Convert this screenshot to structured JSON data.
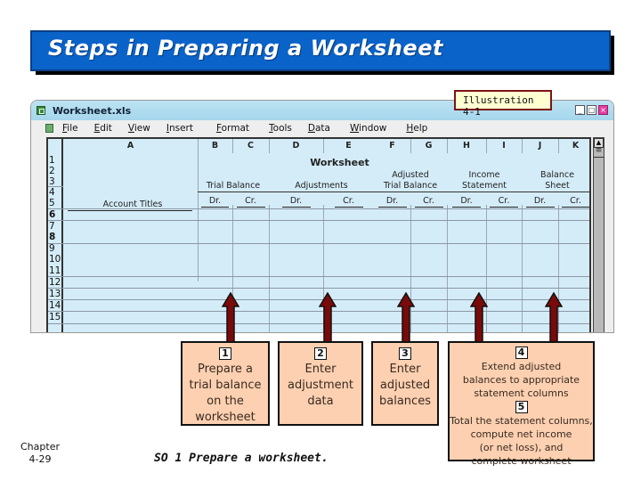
{
  "slide": {
    "title": "Steps in Preparing a Worksheet",
    "illustration_label": "Illustration 4-1",
    "chapter_label": "Chapter",
    "chapter_page": "4-29",
    "study_objective": "SO 1  Prepare a worksheet."
  },
  "window": {
    "title": "Worksheet.xls",
    "controls": [
      "minimize",
      "maximize",
      "close"
    ],
    "menu": [
      "File",
      "Edit",
      "View",
      "Insert",
      "Format",
      "Tools",
      "Data",
      "Window",
      "Help"
    ]
  },
  "sheet": {
    "columns": [
      "A",
      "B",
      "C",
      "D",
      "E",
      "F",
      "G",
      "H",
      "I",
      "J",
      "K"
    ],
    "rows": [
      "1",
      "2",
      "3",
      "4",
      "5",
      "6",
      "7",
      "8",
      "9",
      "10",
      "11",
      "12",
      "13",
      "14",
      "15"
    ],
    "heading": "Worksheet",
    "account_titles": "Account Titles",
    "groups": [
      {
        "line1": "",
        "line2": "Trial Balance"
      },
      {
        "line1": "",
        "line2": "Adjustments"
      },
      {
        "line1": "Adjusted",
        "line2": "Trial Balance"
      },
      {
        "line1": "Income",
        "line2": "Statement"
      },
      {
        "line1": "Balance",
        "line2": "Sheet"
      }
    ],
    "dr_label": "Dr.",
    "cr_label": "Cr."
  },
  "steps": [
    {
      "number": "1",
      "text": [
        "Prepare a",
        "trial balance",
        "on the",
        "worksheet"
      ]
    },
    {
      "number": "2",
      "text": [
        "Enter",
        "adjustment",
        "data"
      ]
    },
    {
      "number": "3",
      "text": [
        "Enter",
        "adjusted",
        "balances"
      ]
    },
    {
      "number": "4",
      "text": [
        "Extend adjusted",
        "balances to appropriate",
        "statement columns"
      ]
    },
    {
      "number": "5",
      "text": [
        "Total the statement columns,",
        "compute net income",
        "(or net loss), and",
        "complete worksheet"
      ]
    }
  ],
  "colors": {
    "title_bg": "#0a63c9",
    "sheet_bg": "#d4ecf8",
    "step_bg": "#fcd0b0",
    "arrow": "#7a0a0a",
    "illus_bg": "#ffffd2"
  }
}
